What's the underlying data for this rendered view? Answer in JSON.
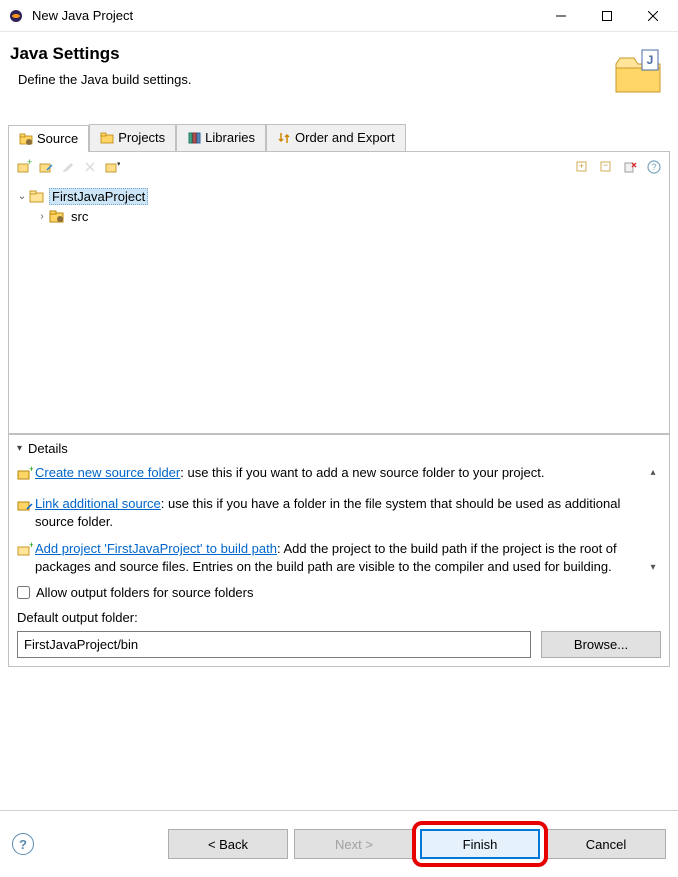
{
  "window": {
    "title": "New Java Project"
  },
  "header": {
    "title": "Java Settings",
    "subtitle": "Define the Java build settings."
  },
  "tabs": {
    "source": "Source",
    "projects": "Projects",
    "libraries": "Libraries",
    "order": "Order and Export"
  },
  "tree": {
    "project": "FirstJavaProject",
    "src": "src"
  },
  "details": {
    "heading": "Details",
    "items": [
      {
        "link": "Create new source folder",
        "rest": ": use this if you want to add a new source folder to your project."
      },
      {
        "link": "Link additional source",
        "rest": ": use this if you have a folder in the file system that should be used as additional source folder."
      },
      {
        "link": "Add project 'FirstJavaProject' to build path",
        "rest": ": Add the project to the build path if the project is the root of packages and source files. Entries on the build path are visible to the compiler and used for building."
      }
    ]
  },
  "allow_output_checkbox": "Allow output folders for source folders",
  "output": {
    "label": "Default output folder:",
    "value": "FirstJavaProject/bin",
    "browse": "Browse..."
  },
  "buttons": {
    "back": "< Back",
    "next": "Next >",
    "finish": "Finish",
    "cancel": "Cancel"
  }
}
